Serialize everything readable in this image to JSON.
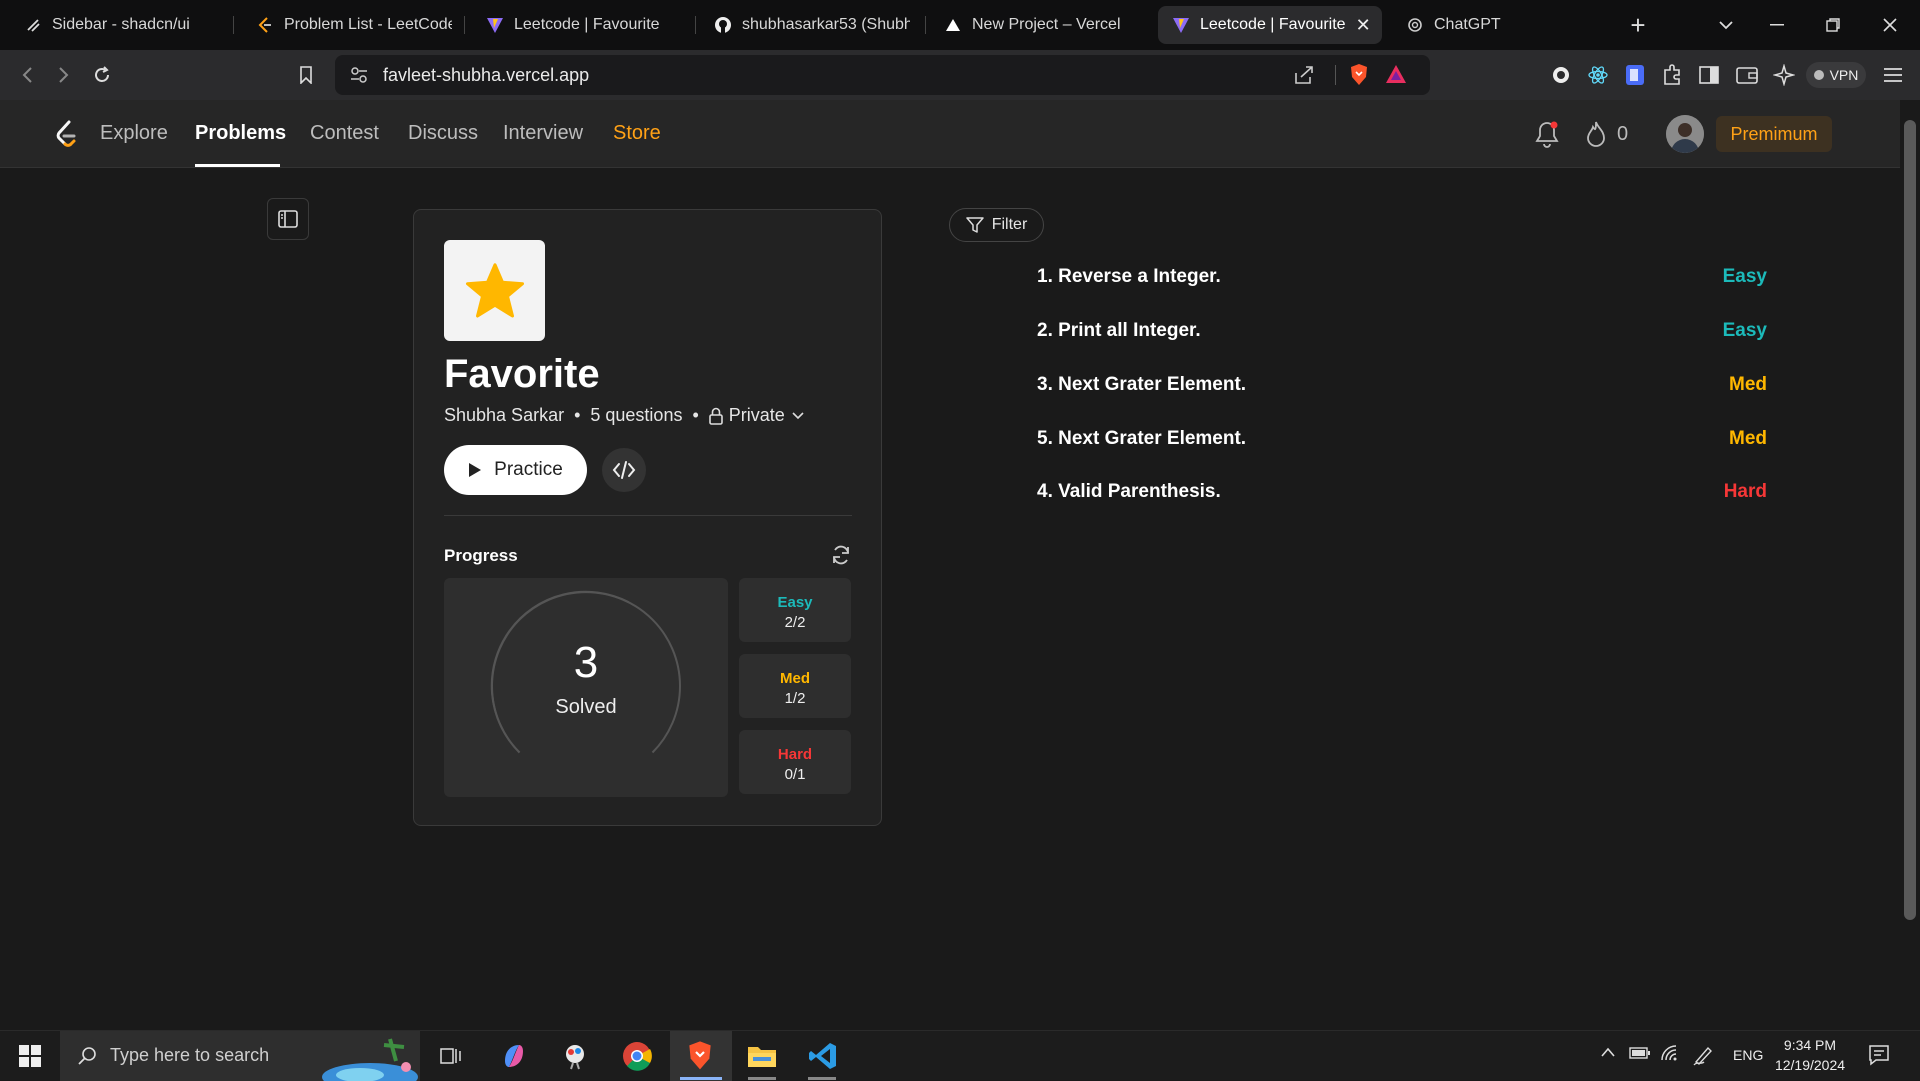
{
  "browser": {
    "tabs": [
      {
        "title": "Sidebar - shadcn/ui",
        "icon": "shadcn-icon"
      },
      {
        "title": "Problem List - LeetCode",
        "icon": "leetcode-icon"
      },
      {
        "title": "Leetcode | Favourite",
        "icon": "vite-icon"
      },
      {
        "title": "shubhasarkar53 (Shubha",
        "icon": "github-icon"
      },
      {
        "title": "New Project – Vercel",
        "icon": "vercel-icon"
      },
      {
        "title": "Leetcode | Favourite",
        "icon": "vite-icon",
        "active": true
      },
      {
        "title": "ChatGPT",
        "icon": "chatgpt-icon"
      }
    ],
    "url": "favleet-shubha.vercel.app",
    "vpn_label": "VPN"
  },
  "app": {
    "nav": [
      "Explore",
      "Problems",
      "Contest",
      "Discuss",
      "Interview",
      "Store"
    ],
    "active_nav": "Problems",
    "streak_count": "0",
    "premium_label": "Premimum"
  },
  "list": {
    "title": "Favorite",
    "author": "Shubha Sarkar",
    "question_count": "5 questions",
    "visibility": "Private",
    "practice_label": "Practice",
    "progress_label": "Progress",
    "solved_count": "3",
    "solved_label": "Solved",
    "solved_fraction": 0.6,
    "difficulty": [
      {
        "label": "Easy",
        "value": "2/2",
        "color": "#1cbaba"
      },
      {
        "label": "Med",
        "value": "1/2",
        "color": "#ffb700"
      },
      {
        "label": "Hard",
        "value": "0/1",
        "color": "#f63737"
      }
    ]
  },
  "filter_label": "Filter",
  "questions": [
    {
      "title": "1. Reverse a Integer.",
      "difficulty": "Easy",
      "color": "#1cbaba"
    },
    {
      "title": "2. Print all Integer.",
      "difficulty": "Easy",
      "color": "#1cbaba"
    },
    {
      "title": "3. Next Grater Element.",
      "difficulty": "Med",
      "color": "#ffb700"
    },
    {
      "title": "5. Next Grater Element.",
      "difficulty": "Med",
      "color": "#ffb700"
    },
    {
      "title": "4. Valid Parenthesis.",
      "difficulty": "Hard",
      "color": "#f63737"
    }
  ],
  "taskbar": {
    "search_placeholder": "Type here to search",
    "language": "ENG",
    "time": "9:34 PM",
    "date": "12/19/2024"
  }
}
